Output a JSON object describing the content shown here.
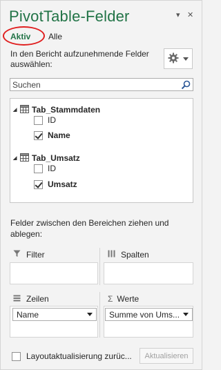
{
  "header": {
    "title": "PivotTable-Felder",
    "dropdown_glyph": "▾",
    "close_glyph": "✕"
  },
  "tabs": [
    {
      "label": "Aktiv",
      "active": true
    },
    {
      "label": "Alle",
      "active": false
    }
  ],
  "instruction": "In den Bericht aufzunehmende Felder auswählen:",
  "search": {
    "placeholder": "Suchen"
  },
  "tables": [
    {
      "name": "Tab_Stammdaten",
      "fields": [
        {
          "label": "ID",
          "checked": false
        },
        {
          "label": "Name",
          "checked": true
        }
      ]
    },
    {
      "name": "Tab_Umsatz",
      "fields": [
        {
          "label": "ID",
          "checked": false
        },
        {
          "label": "Umsatz",
          "checked": true
        }
      ]
    }
  ],
  "areas_instruction": "Felder zwischen den Bereichen ziehen und ablegen:",
  "areas": {
    "filter": {
      "label": "Filter"
    },
    "columns": {
      "label": "Spalten"
    },
    "rows": {
      "label": "Zeilen",
      "value": "Name"
    },
    "values": {
      "label": "Werte",
      "value": "Summe von Ums..."
    }
  },
  "footer": {
    "defer_label": "Layoutaktualisierung zurüc...",
    "update_label": "Aktualisieren"
  },
  "colors": {
    "accent": "#217346",
    "annotation": "#e02020"
  }
}
